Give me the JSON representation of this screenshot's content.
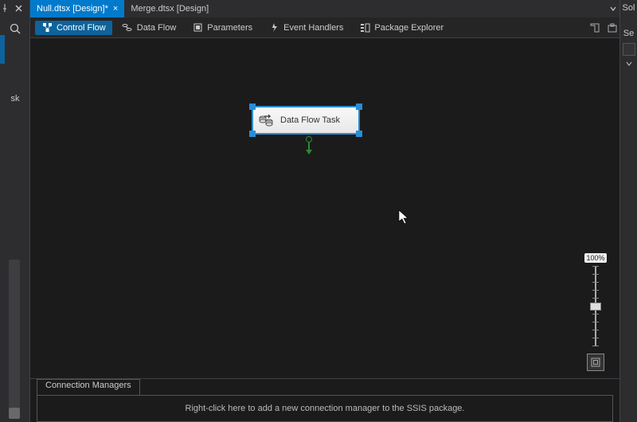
{
  "left_rail": {
    "vertical_label": "sk"
  },
  "tabs": [
    {
      "label": "Null.dtsx [Design]*",
      "active": true,
      "closeable": true
    },
    {
      "label": "Merge.dtsx [Design]",
      "active": false,
      "closeable": false
    }
  ],
  "toolbar": {
    "items": [
      {
        "label": "Control Flow",
        "active": true
      },
      {
        "label": "Data Flow",
        "active": false
      },
      {
        "label": "Parameters",
        "active": false
      },
      {
        "label": "Event Handlers",
        "active": false
      },
      {
        "label": "Package Explorer",
        "active": false
      }
    ]
  },
  "canvas": {
    "task_label": "Data Flow Task"
  },
  "zoom": {
    "label": "100%"
  },
  "connection_managers": {
    "tab_label": "Connection Managers",
    "hint": "Right-click here to add a new connection manager to the SSIS package."
  },
  "right_rail": {
    "label": "Sol",
    "sub": "Se"
  }
}
